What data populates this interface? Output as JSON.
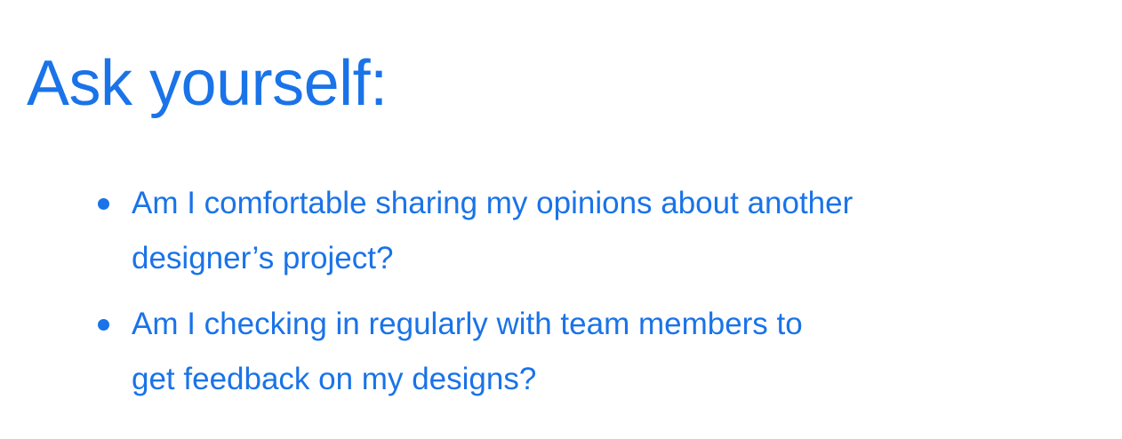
{
  "slide": {
    "title": "Ask yourself:",
    "accent_color": "#1a73e8",
    "bullets": [
      {
        "line1": "Am I comfortable sharing my opinions about another",
        "line2": "designer’s project?"
      },
      {
        "line1": "Am I checking in regularly with team members to",
        "line2": "get feedback on my designs?"
      }
    ]
  }
}
